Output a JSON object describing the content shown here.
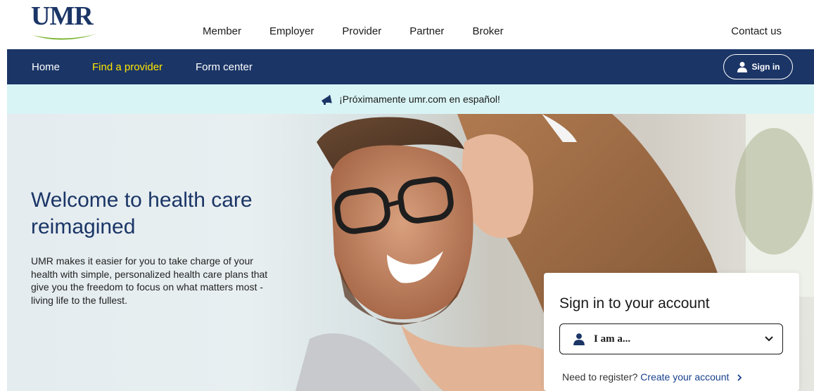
{
  "brand": {
    "logo_text": "UMR"
  },
  "audience_nav": {
    "items": [
      {
        "label": "Member"
      },
      {
        "label": "Employer"
      },
      {
        "label": "Provider"
      },
      {
        "label": "Partner"
      },
      {
        "label": "Broker"
      }
    ],
    "contact_label": "Contact us"
  },
  "main_nav": {
    "items": [
      {
        "label": "Home",
        "active": false
      },
      {
        "label": "Find a provider",
        "active": true
      },
      {
        "label": "Form center",
        "active": false
      }
    ],
    "signin_label": "Sign in",
    "active_color": "#ffe600",
    "background": "#1b3566"
  },
  "announcement": {
    "icon": "megaphone-icon",
    "text": "¡Próximamente umr.com en español!",
    "background": "#d9f4f5"
  },
  "hero": {
    "title": "Welcome to health care reimagined",
    "description": "UMR makes it easier for you to take charge of your health with simple, personalized health care plans that give you the freedom to focus on what matters most - living life to the fullest.",
    "image": "father-and-daughter-photo"
  },
  "signin_card": {
    "title": "Sign in to your account",
    "role_select": {
      "selected": "I am a...",
      "icon": "person-icon"
    },
    "register_prompt": "Need to register?",
    "register_link": "Create your account",
    "register_link_icon": "chevron-right-icon"
  }
}
